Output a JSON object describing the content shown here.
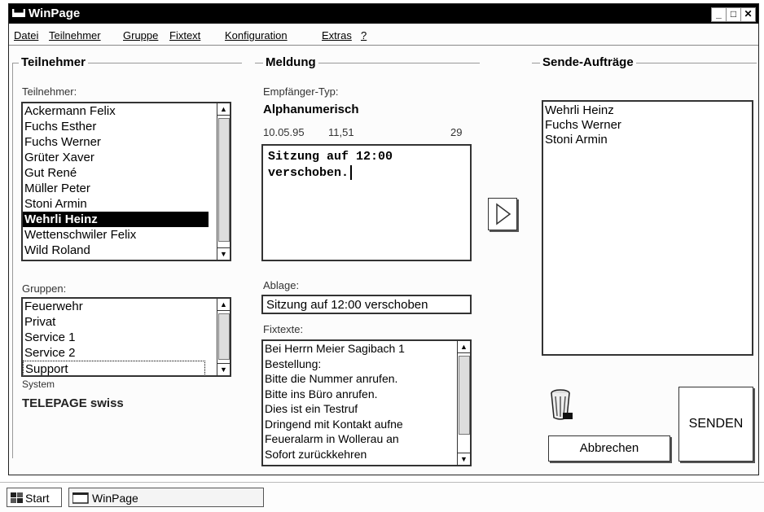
{
  "window": {
    "title": "WinPage"
  },
  "menu": [
    "Datei",
    "Teilnehmer",
    "Gruppe",
    "Fixtext",
    "Konfiguration",
    "Extras",
    "?"
  ],
  "teilnehmer_group": {
    "title": "Teilnehmer",
    "list_label": "Teilnehmer:",
    "items": [
      "Ackermann Felix",
      "Fuchs Esther",
      "Fuchs Werner",
      "Grüter Xaver",
      "Gut René",
      "Müller Peter",
      "Stoni Armin",
      "Wehrli Heinz",
      "Wettenschwiler Felix",
      "Wild Roland"
    ],
    "selected": "Wehrli Heinz",
    "gruppen_label": "Gruppen:",
    "gruppen": [
      "Feuerwehr",
      "Privat",
      "Service 1",
      "Service 2",
      "Support"
    ],
    "system_label": "System",
    "system_value": "TELEPAGE swiss"
  },
  "meldung_group": {
    "title": "Meldung",
    "type_label": "Empfänger-Typ:",
    "type_value": "Alphanumerisch",
    "date": "10.05.95",
    "time": "11,51",
    "count": "29",
    "message_line1": "Sitzung auf 12:00",
    "message_line2": "verschoben.",
    "ablage_label": "Ablage:",
    "ablage_value": "Sitzung auf 12:00 verschoben",
    "fixtexte_label": "Fixtexte:",
    "fixtexte": [
      "Bei Herrn Meier Sagibach 1",
      "Bestellung:",
      "Bitte die Nummer anrufen.",
      "Bitte ins Büro anrufen.",
      "Dies ist ein Testruf",
      "Dringend mit Kontakt aufne",
      "Feueralarm in Wollerau an",
      "Sofort zurückkehren"
    ]
  },
  "sende_group": {
    "title": "Sende-Aufträge",
    "items": [
      "Wehrli Heinz",
      "Fuchs Werner",
      "Stoni Armin"
    ]
  },
  "buttons": {
    "abbrechen": "Abbrechen",
    "senden": "SENDEN"
  },
  "taskbar": {
    "start": "Start",
    "app": "WinPage"
  }
}
